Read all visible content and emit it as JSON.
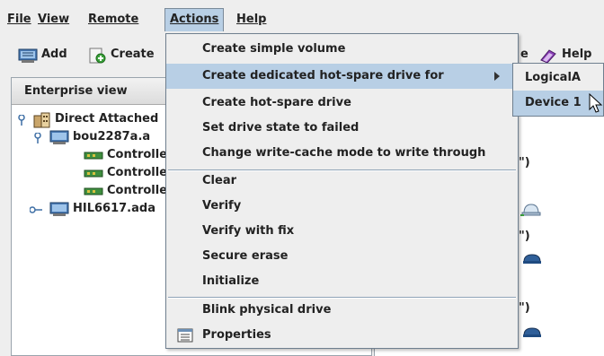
{
  "menubar": {
    "file": "File",
    "view": "View",
    "remote": "Remote",
    "actions": "Actions",
    "help": "Help"
  },
  "toolbar": {
    "add": "Add",
    "create": "Create",
    "help_partial": "Help",
    "e_partial": "e"
  },
  "left_panel": {
    "header": "Enterprise view",
    "tree": [
      {
        "label": "Direct Attached"
      },
      {
        "label": "bou2287a.a"
      },
      {
        "label": "Controlle"
      },
      {
        "label": "Controlle"
      },
      {
        "label": "Controlle"
      },
      {
        "label": "HIL6617.ada"
      }
    ]
  },
  "right_panel": {
    "frag1": "\")",
    "frag2": "\")",
    "frag3": "\")"
  },
  "actions_menu": {
    "items": [
      {
        "label": "Create simple volume"
      },
      {
        "label": "Create dedicated hot-spare drive for"
      },
      {
        "label": "Create hot-spare drive"
      },
      {
        "label": "Set drive state to failed"
      },
      {
        "label": "Change write-cache mode to write through"
      },
      {
        "label": "Clear"
      },
      {
        "label": "Verify"
      },
      {
        "label": "Verify with fix"
      },
      {
        "label": "Secure erase"
      },
      {
        "label": "Initialize"
      },
      {
        "label": "Blink physical drive"
      },
      {
        "label": "Properties"
      }
    ]
  },
  "submenu": {
    "items": [
      {
        "label": "LogicalA"
      },
      {
        "label": "Device 1"
      }
    ]
  },
  "colors": {
    "highlight": "#b8cfe5",
    "menu_bg": "#eeeeee",
    "border": "#6f7f8f"
  }
}
